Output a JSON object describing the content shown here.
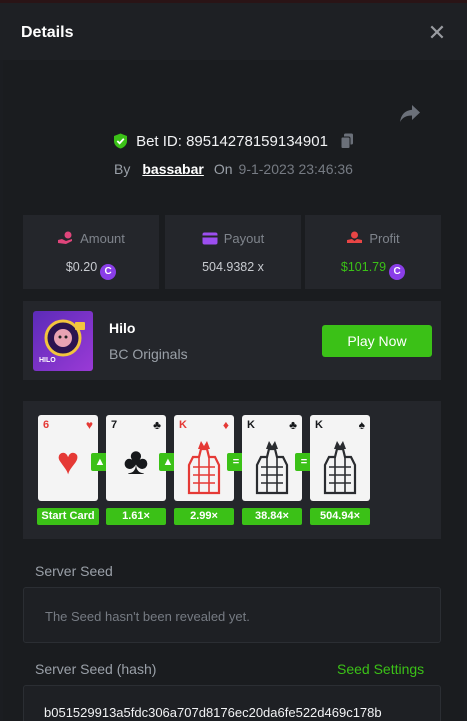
{
  "header": {
    "title": "Details",
    "close_icon": "close-icon"
  },
  "bet": {
    "id_label": "Bet ID:",
    "id_value": "89514278159134901",
    "by_label": "By",
    "user": "bassabar",
    "on_label": "On",
    "date": "9-1-2023 23:46:36"
  },
  "stats": {
    "amount": {
      "label": "Amount",
      "value": "$0.20",
      "icon": "coins-hand-icon"
    },
    "payout": {
      "label": "Payout",
      "value": "504.9382 x",
      "icon": "wallet-icon"
    },
    "profit": {
      "label": "Profit",
      "value": "$101.79",
      "icon": "coins-profit-icon"
    },
    "coin_symbol": "C"
  },
  "game": {
    "name": "Hilo",
    "provider": "BC Originals",
    "thumb_label": "HILO",
    "play_label": "Play Now"
  },
  "cards": [
    {
      "rank": "6",
      "suit": "♥",
      "color": "red",
      "multiplier": "Start Card"
    },
    {
      "rank": "7",
      "suit": "♣",
      "color": "black",
      "multiplier": "1.61×"
    },
    {
      "rank": "K",
      "suit": "♦",
      "color": "red",
      "multiplier": "2.99×"
    },
    {
      "rank": "K",
      "suit": "♣",
      "color": "black",
      "multiplier": "38.84×"
    },
    {
      "rank": "K",
      "suit": "♠",
      "color": "black",
      "multiplier": "504.94×"
    }
  ],
  "guesses": [
    "▲",
    "▲",
    "=",
    "="
  ],
  "seeds": {
    "server_seed_label": "Server Seed",
    "server_seed_value": "The Seed hasn't been revealed yet.",
    "server_hash_label": "Server Seed (hash)",
    "seed_settings_label": "Seed Settings",
    "server_hash_value": "b051529913a5fdc306a707d8176ec20da6fe522d469c178b"
  },
  "colors": {
    "accent": "#3bc117",
    "amount_icon": "#e0457b",
    "payout_icon": "#9c4ef0",
    "profit_icon": "#e94545"
  }
}
